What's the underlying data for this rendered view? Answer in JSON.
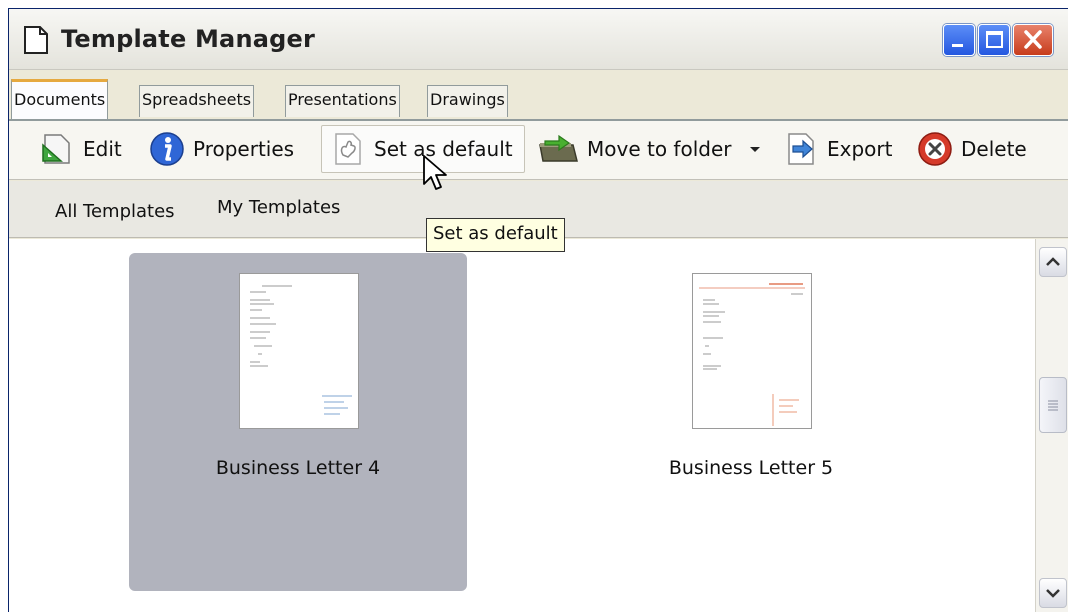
{
  "window": {
    "title": "Template Manager",
    "buttons": [
      "minimize",
      "maximize",
      "close"
    ]
  },
  "tabs": [
    {
      "label": "Documents",
      "active": true
    },
    {
      "label": "Spreadsheets",
      "active": false
    },
    {
      "label": "Presentations",
      "active": false
    },
    {
      "label": "Drawings",
      "active": false
    }
  ],
  "toolbar": {
    "edit": {
      "label": "Edit",
      "icon": "edit-icon"
    },
    "properties": {
      "label": "Properties",
      "icon": "info-icon"
    },
    "set_default": {
      "label": "Set as default",
      "icon": "set-default-icon"
    },
    "move": {
      "label": "Move to folder",
      "icon": "move-folder-icon"
    },
    "export": {
      "label": "Export",
      "icon": "export-icon"
    },
    "delete": {
      "label": "Delete",
      "icon": "delete-icon"
    }
  },
  "filters": {
    "all": "All Templates",
    "mine": "My Templates"
  },
  "templates": [
    {
      "name": "Business Letter 4",
      "selected": true
    },
    {
      "name": "Business Letter 5",
      "selected": false
    }
  ],
  "tooltip": "Set as default",
  "colors": {
    "selection": "#b1b3bd",
    "active_tab_accent": "#e6a93f",
    "close_button": "#c73c1c",
    "tooltip_bg": "#ffffe1"
  }
}
